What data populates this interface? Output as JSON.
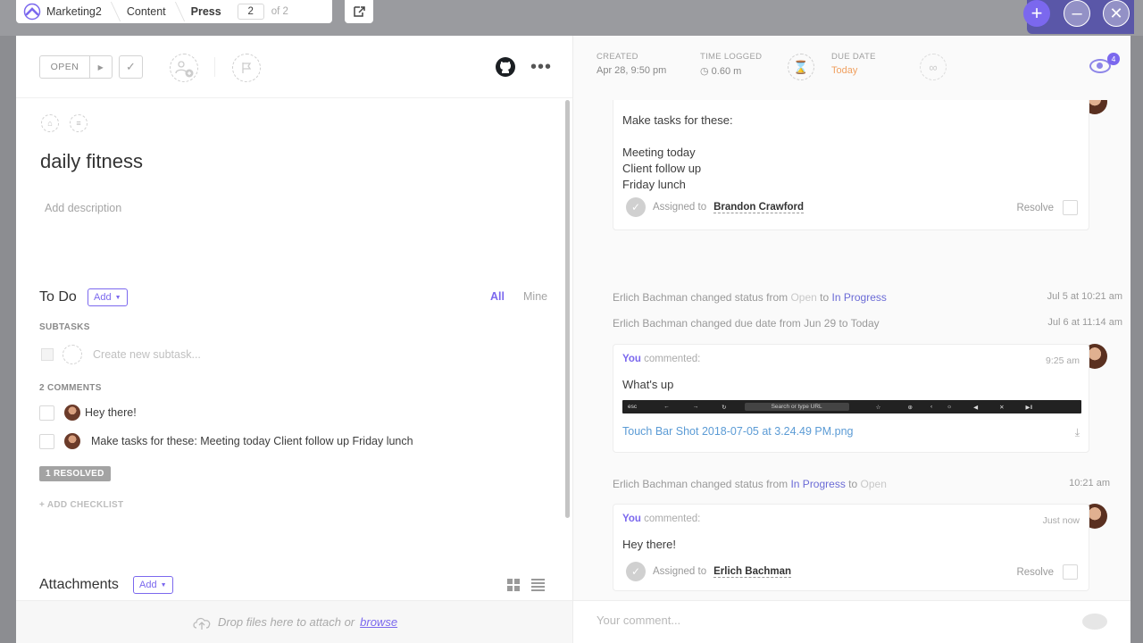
{
  "breadcrumb": {
    "items": [
      "Marketing2",
      "Content",
      "Press"
    ],
    "page_current": "2",
    "page_total": "of 2"
  },
  "task": {
    "status": "OPEN",
    "title": "daily fitness",
    "description_placeholder": "Add description"
  },
  "todo": {
    "title": "To Do",
    "add_label": "Add",
    "tab_all": "All",
    "tab_mine": "Mine",
    "subtasks_label": "SUBTASKS",
    "subtask_placeholder": "Create new subtask...",
    "comments_label": "2 COMMENTS",
    "items": [
      {
        "text": "Hey there!"
      },
      {
        "text": "Make tasks for these: Meeting today Client follow up Friday lunch"
      }
    ],
    "resolved_label": "1 RESOLVED",
    "add_checklist": "+ ADD CHECKLIST"
  },
  "attachments": {
    "title": "Attachments",
    "add_label": "Add",
    "drop_text": "Drop files here to attach or",
    "browse": "browse"
  },
  "meta": {
    "created_label": "CREATED",
    "created_value": "Apr 28, 9:50 pm",
    "time_label": "TIME LOGGED",
    "time_value": "0.60 m",
    "due_label": "DUE DATE",
    "due_value": "Today",
    "watchers": "4"
  },
  "feed": {
    "card1": {
      "lines": [
        "Make tasks for these:",
        "Meeting today",
        "Client follow up",
        "Friday lunch"
      ],
      "assigned_prefix": "Assigned to",
      "assignee": "Brandon Crawford",
      "resolve": "Resolve"
    },
    "activity1": {
      "actor": "Erlich Bachman",
      "action": "changed status from",
      "from": "Open",
      "to_word": "to",
      "to": "In Progress",
      "when": "Jul 5 at 10:21 am"
    },
    "activity2": {
      "text": "Erlich Bachman changed due date from Jun 29 to Today",
      "when": "Jul 6 at 11:14 am"
    },
    "card2": {
      "by": "You",
      "verb": "commented:",
      "time": "9:25 am",
      "body": "What's up",
      "touchbar_esc": "esc",
      "touchbar_url": "Search or type URL",
      "file": "Touch Bar Shot 2018-07-05 at 3.24.49 PM.png"
    },
    "activity3": {
      "actor": "Erlich Bachman",
      "action": "changed status from",
      "from": "In Progress",
      "to_word": "to",
      "to": "Open",
      "when": "10:21 am"
    },
    "card3": {
      "by": "You",
      "verb": "commented:",
      "time": "Just now",
      "body": "Hey there!",
      "assigned_prefix": "Assigned to",
      "assignee": "Erlich Bachman",
      "resolve": "Resolve"
    }
  },
  "comment_input": {
    "placeholder": "Your comment..."
  },
  "colors": {
    "accent": "#7b68ee",
    "due": "#f0a060",
    "link": "#5b9bd5"
  }
}
